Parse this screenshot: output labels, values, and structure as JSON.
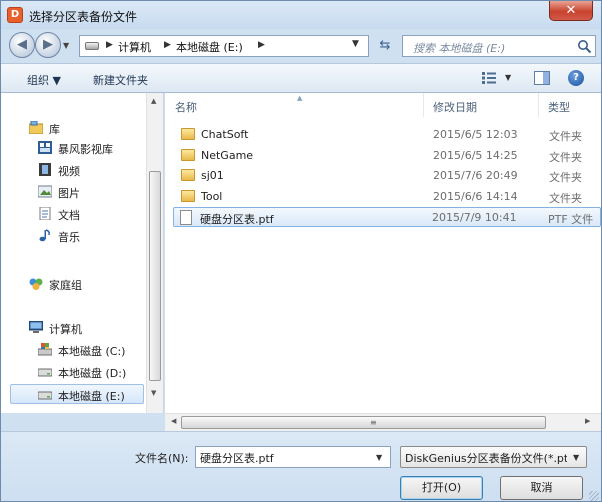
{
  "window": {
    "title": "选择分区表备份文件",
    "app_icon": "diskgenius-icon",
    "close_label": "✕"
  },
  "address": {
    "crumbs": [
      "计算机",
      "本地磁盘 (E:)"
    ],
    "search_placeholder": "搜索 本地磁盘 (E:)"
  },
  "toolbar": {
    "organize_label": "组织 ▼",
    "new_folder_label": "新建文件夹",
    "help_label": "?"
  },
  "nav": {
    "libraries": {
      "label": "库",
      "items": [
        {
          "label": "暴风影视库",
          "icon": "media-library-icon"
        },
        {
          "label": "视频",
          "icon": "video-icon"
        },
        {
          "label": "图片",
          "icon": "picture-icon"
        },
        {
          "label": "文档",
          "icon": "document-icon"
        },
        {
          "label": "音乐",
          "icon": "music-icon"
        }
      ]
    },
    "homegroup": {
      "label": "家庭组",
      "icon": "homegroup-icon"
    },
    "computer": {
      "label": "计算机",
      "drives": [
        {
          "label": "本地磁盘 (C:)",
          "icon": "system-drive-icon"
        },
        {
          "label": "本地磁盘 (D:)",
          "icon": "drive-icon"
        },
        {
          "label": "本地磁盘 (E:)",
          "icon": "drive-icon",
          "selected": true
        }
      ]
    }
  },
  "columns": {
    "name": "名称",
    "modified": "修改日期",
    "type": "类型"
  },
  "files": [
    {
      "name": "ChatSoft",
      "date": "2015/6/5 12:03",
      "type": "文件夹",
      "icon": "folder-icon"
    },
    {
      "name": "NetGame",
      "date": "2015/6/5 14:25",
      "type": "文件夹",
      "icon": "folder-icon"
    },
    {
      "name": "sj01",
      "date": "2015/7/6 20:49",
      "type": "文件夹",
      "icon": "folder-icon"
    },
    {
      "name": "Tool",
      "date": "2015/6/6 14:14",
      "type": "文件夹",
      "icon": "folder-icon"
    },
    {
      "name": "硬盘分区表.ptf",
      "date": "2015/7/9 10:41",
      "type": "PTF 文件",
      "icon": "file-icon",
      "selected": true
    }
  ],
  "footer": {
    "filename_label": "文件名(N):",
    "filename_value": "硬盘分区表.ptf",
    "filter_value": "DiskGenius分区表备份文件(*.ptf)",
    "open_label": "打开(O)",
    "cancel_label": "取消"
  },
  "colors": {
    "chrome": "#cfe0f1",
    "selection": "#d9e8f9",
    "close": "#c8432e"
  }
}
